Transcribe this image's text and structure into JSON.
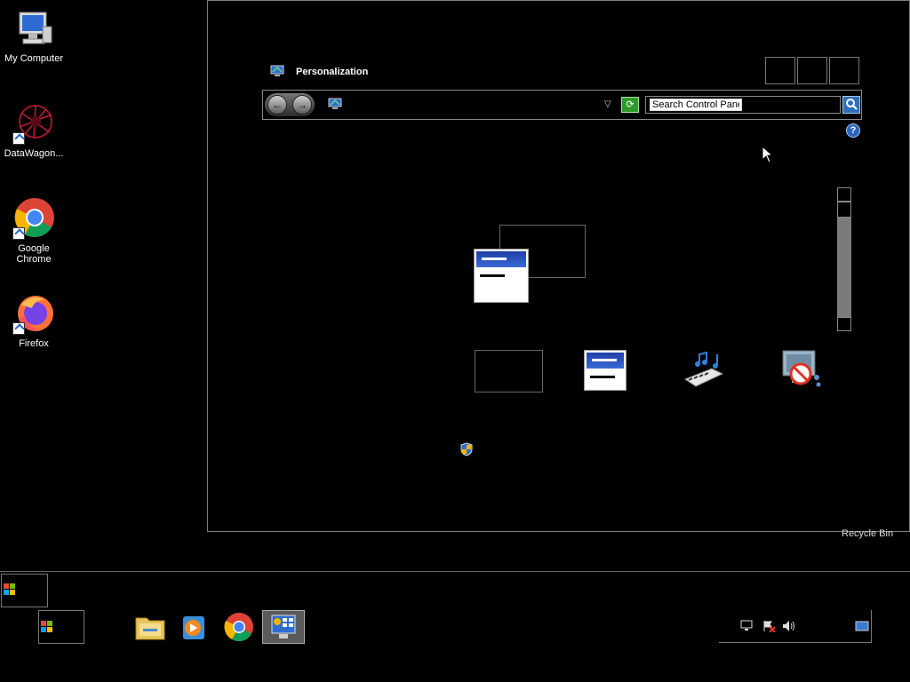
{
  "desktop": {
    "icons": [
      {
        "label": "My Computer",
        "icon": "computer-icon"
      },
      {
        "label": "DataWagon...",
        "icon": "datawagon-icon"
      },
      {
        "label": "Google Chrome",
        "icon": "chrome-icon"
      },
      {
        "label": "Firefox",
        "icon": "firefox-icon"
      }
    ],
    "recycle_bin_label": "Recycle Bin"
  },
  "window": {
    "title": "Personalization",
    "search_placeholder": "Search Control Panel",
    "help_label": "?",
    "refresh_label": "⟳",
    "dropdown_glyph": "▽",
    "back_glyph": "←",
    "forward_glyph": "→"
  },
  "taskbar": {
    "pinned": [
      "file-explorer-icon",
      "media-player-icon",
      "chrome-icon",
      "control-panel-icon"
    ],
    "tray_icons": [
      "network-icon",
      "action-center-icon",
      "volume-icon",
      "show-desktop-icon"
    ]
  },
  "colors": {
    "accent_blue": "#2f6fb8",
    "refresh_green": "#2f9a2b",
    "window_border": "#7f7f7f"
  }
}
